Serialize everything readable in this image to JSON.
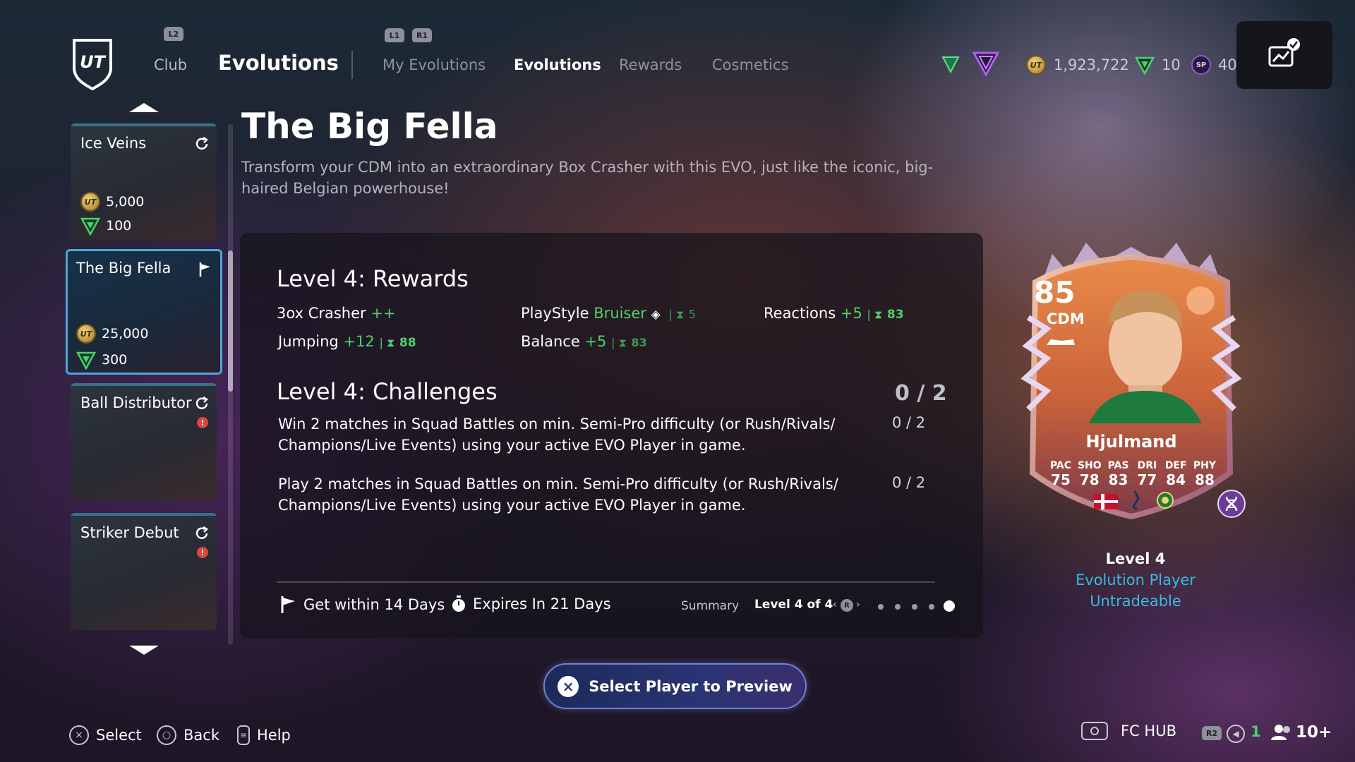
{
  "nav": {
    "club_trigger": "L2",
    "club": "Club",
    "section": "Evolutions",
    "shoulder_left": "L1",
    "shoulder_right": "R1",
    "tabs": [
      "My Evolutions",
      "Evolutions",
      "Rewards",
      "Cosmetics"
    ],
    "active_tab": "Evolutions"
  },
  "currency": {
    "coins": "1,923,722",
    "points": "10",
    "sp_label": "SP",
    "sp": "40",
    "coin_glyph": "UT"
  },
  "evolutions_list": [
    {
      "name": "Ice Veins",
      "coins": "5,000",
      "points": "100",
      "status": "refresh-icon"
    },
    {
      "name": "The Big Fella",
      "coins": "25,000",
      "points": "300",
      "status": "flag-icon",
      "selected": true
    },
    {
      "name": "Ball Distributor",
      "status": "refresh-icon",
      "alert": "!"
    },
    {
      "name": "Striker Debut",
      "status": "refresh-icon",
      "alert": "!"
    }
  ],
  "detail": {
    "title": "The Big Fella",
    "description": "Transform your CDM into an extraordinary Box Crasher with this EVO, just like the iconic, big-haired Belgian powerhouse!",
    "rewards_title": "Level 4: Rewards",
    "rewards": [
      {
        "name": "3ox Crasher",
        "value": "++",
        "cap": ""
      },
      {
        "name": "PlayStyle",
        "value": "Bruiser",
        "cap": "5"
      },
      {
        "name": "Reactions",
        "value": "+5",
        "cap": "83"
      },
      {
        "name": "Jumping",
        "value": "+12",
        "cap": "88"
      },
      {
        "name": "Balance",
        "value": "+5",
        "cap": "83"
      }
    ],
    "challenges_title": "Level 4: Challenges",
    "challenges_total": "0 / 2",
    "challenges": [
      {
        "text": "Win 2 matches in Squad Battles on min. Semi-Pro difficulty (or Rush/Rivals/ Champions/Live Events) using your active EVO Player in game.",
        "progress": "0 / 2"
      },
      {
        "text": "Play 2 matches in Squad Battles on min. Semi-Pro difficulty (or Rush/Rivals/ Champions/Live Events) using your active EVO Player in game.",
        "progress": "0 / 2"
      }
    ],
    "get_within": "Get within 14 Days",
    "expires": "Expires In 21 Days",
    "summary": "Summary",
    "level_indicator": "Level 4 of 4",
    "level_trigger": "R"
  },
  "player_card": {
    "rating": "85",
    "position": "CDM",
    "name": "Hjulmand",
    "stats": [
      {
        "label": "PAC",
        "value": "75"
      },
      {
        "label": "SHO",
        "value": "78"
      },
      {
        "label": "PAS",
        "value": "83"
      },
      {
        "label": "DRI",
        "value": "77"
      },
      {
        "label": "DEF",
        "value": "84"
      },
      {
        "label": "PHY",
        "value": "88"
      }
    ],
    "level": "Level 4",
    "type": "Evolution Player",
    "tradeable": "Untradeable"
  },
  "actions": {
    "preview": "Select Player to Preview",
    "select": "Select",
    "back": "Back",
    "help": "Help",
    "fc_hub": "FC HUB",
    "r2": "R2",
    "notifications": "1",
    "friends": "10+"
  },
  "colors": {
    "accent_green": "#4fd06a",
    "accent_blue": "#39b9e6",
    "selected_border": "#4ea7d8",
    "alert_red": "#e0453a"
  }
}
